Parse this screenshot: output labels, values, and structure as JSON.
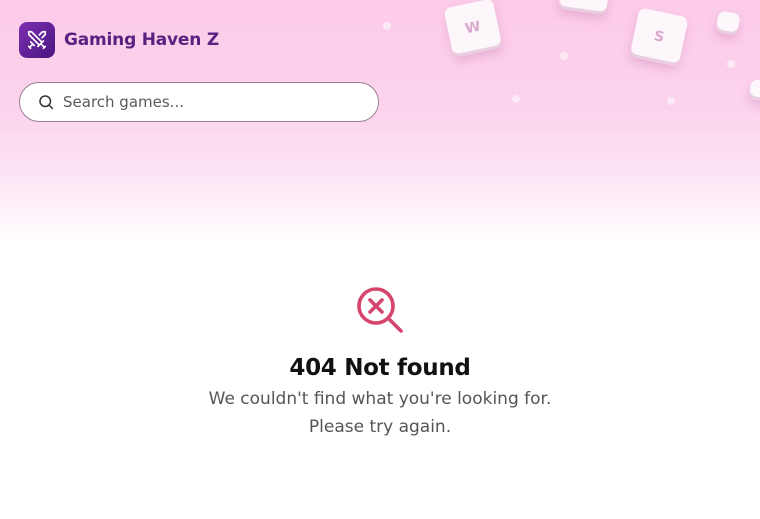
{
  "brand": {
    "name": "Gaming Haven Z",
    "icon": "crossed-swords-icon",
    "color": "#5b2180"
  },
  "search": {
    "placeholder": "Search games...",
    "value": "",
    "icon": "search-icon"
  },
  "decor_keys": [
    "W",
    "S"
  ],
  "not_found": {
    "icon": "search-x-icon",
    "title": "404 Not found",
    "message_line1": "We couldn't find what you're looking for.",
    "message_line2": "Please try again.",
    "accent_color": "#d6456e"
  }
}
